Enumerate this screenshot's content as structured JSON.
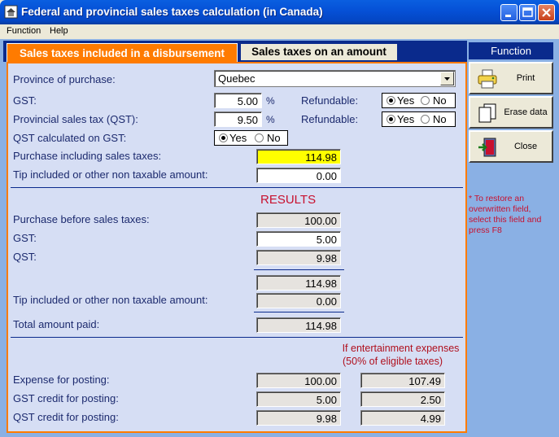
{
  "window": {
    "title": "Federal and provincial sales taxes calculation (in Canada)"
  },
  "menu": {
    "items": [
      "Function",
      "Help"
    ]
  },
  "tabs": [
    {
      "label": "Sales taxes included in a disbursement",
      "active": true
    },
    {
      "label": "Sales taxes on an amount",
      "active": false
    }
  ],
  "form": {
    "province_label": "Province of purchase:",
    "province_value": "Quebec",
    "gst_label": "GST:",
    "gst_rate": "5.00",
    "pst_label": "Provincial sales tax (QST):",
    "pst_rate": "9.50",
    "percent": "%",
    "refundable_label": "Refundable:",
    "gst_refundable": "Yes",
    "pst_refundable": "Yes",
    "yes": "Yes",
    "no": "No",
    "qst_on_gst_label": "QST calculated on GST:",
    "qst_on_gst": "Yes",
    "purchase_incl_label": "Purchase including sales taxes:",
    "purchase_incl_value": "114.98",
    "tip_label": "Tip included or other non taxable amount:",
    "tip_value": "0.00"
  },
  "results": {
    "title": "RESULTS",
    "before_label": "Purchase before sales taxes:",
    "before_value": "100.00",
    "gst_label": "GST:",
    "gst_value": "5.00",
    "qst_label": "QST:",
    "qst_value": "9.98",
    "subtotal_value": "114.98",
    "tip_label": "Tip included or other non taxable amount:",
    "tip_value": "0.00",
    "total_label": "Total amount paid:",
    "total_value": "114.98"
  },
  "entertainment": {
    "heading_1": "If entertainment expenses",
    "heading_2": "(50% of eligible taxes)",
    "expense_label": "Expense for posting:",
    "expense_value": "100.00",
    "expense_ent_value": "107.49",
    "gst_credit_label": "GST credit for posting:",
    "gst_credit_value": "5.00",
    "gst_credit_ent_value": "2.50",
    "qst_credit_label": "QST credit for posting:",
    "qst_credit_value": "9.98",
    "qst_credit_ent_value": "4.99"
  },
  "function_panel": {
    "header": "Function",
    "buttons": [
      {
        "label": "Print",
        "icon": "printer-icon"
      },
      {
        "label": "Erase data",
        "icon": "pages-icon"
      },
      {
        "label": "Close",
        "icon": "exit-door-icon"
      }
    ],
    "note": "* To restore an overwritten field, select this field and press F8"
  },
  "colors": {
    "tab_active": "#ff7b00",
    "navy": "#0a2a8c",
    "highlight": "#ffff00",
    "results_red": "#c8102e"
  }
}
